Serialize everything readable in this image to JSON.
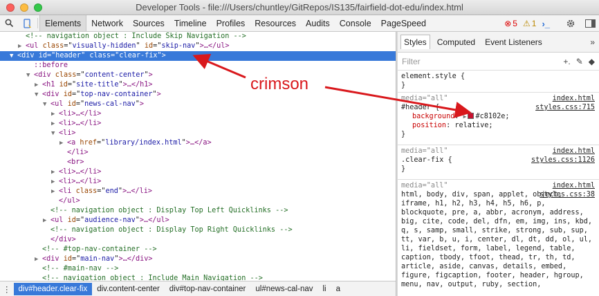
{
  "window": {
    "title": "Developer Tools - file:///Users/chuntley/GitRepos/IS135/fairfield-dot-edu/index.html",
    "light_colors": [
      "#fc605c",
      "#fdbc40",
      "#34c84a"
    ]
  },
  "toolbar": {
    "tabs": [
      "Elements",
      "Network",
      "Sources",
      "Timeline",
      "Profiles",
      "Resources",
      "Audits",
      "Console",
      "PageSpeed"
    ],
    "active_tab": "Elements",
    "error_count": "5",
    "warning_count": "1"
  },
  "dom_lines": [
    {
      "indent": 3,
      "tri": "",
      "kind": "comment",
      "text": "<!-- navigation object : Include Skip Navigation -->"
    },
    {
      "indent": 3,
      "tri": "▶",
      "kind": "tag",
      "tag": "ul",
      "attrs": [
        [
          "class",
          "visually-hidden"
        ],
        [
          "id",
          "skip-nav"
        ]
      ],
      "tail": "…</ul>"
    },
    {
      "indent": 2,
      "tri": "▼",
      "kind": "tag",
      "tag": "div",
      "attrs": [
        [
          "id",
          "header"
        ],
        [
          "class",
          "clear-fix"
        ]
      ],
      "tail": "",
      "selected": true
    },
    {
      "indent": 4,
      "tri": "",
      "kind": "pseudo",
      "text": "::before"
    },
    {
      "indent": 4,
      "tri": "▼",
      "kind": "tag",
      "tag": "div",
      "attrs": [
        [
          "class",
          "content-center"
        ]
      ],
      "tail": ""
    },
    {
      "indent": 5,
      "tri": "▶",
      "kind": "tag",
      "tag": "h1",
      "attrs": [
        [
          "id",
          "site-title"
        ]
      ],
      "tail": "…</h1>"
    },
    {
      "indent": 5,
      "tri": "▼",
      "kind": "tag",
      "tag": "div",
      "attrs": [
        [
          "id",
          "top-nav-container"
        ]
      ],
      "tail": ""
    },
    {
      "indent": 6,
      "tri": "▼",
      "kind": "tag",
      "tag": "ul",
      "attrs": [
        [
          "id",
          "news-cal-nav"
        ]
      ],
      "tail": ""
    },
    {
      "indent": 7,
      "tri": "▶",
      "kind": "tag",
      "tag": "li",
      "attrs": [],
      "tail": "…</li>"
    },
    {
      "indent": 7,
      "tri": "▶",
      "kind": "tag",
      "tag": "li",
      "attrs": [],
      "tail": "…</li>"
    },
    {
      "indent": 7,
      "tri": "▼",
      "kind": "tag",
      "tag": "li",
      "attrs": [],
      "tail": ""
    },
    {
      "indent": 8,
      "tri": "▶",
      "kind": "tag",
      "tag": "a",
      "attrs": [
        [
          "href",
          "library/index.html"
        ]
      ],
      "tail": "…</a>"
    },
    {
      "indent": 8,
      "tri": "",
      "kind": "close",
      "text": "</li>"
    },
    {
      "indent": 8,
      "tri": "",
      "kind": "close",
      "text": "<br>"
    },
    {
      "indent": 7,
      "tri": "▶",
      "kind": "tag",
      "tag": "li",
      "attrs": [],
      "tail": "…</li>"
    },
    {
      "indent": 7,
      "tri": "▶",
      "kind": "tag",
      "tag": "li",
      "attrs": [],
      "tail": "…</li>"
    },
    {
      "indent": 7,
      "tri": "▶",
      "kind": "tag",
      "tag": "li",
      "attrs": [
        [
          "class",
          "end"
        ]
      ],
      "tail": "…</li>"
    },
    {
      "indent": 7,
      "tri": "",
      "kind": "close",
      "text": "</ul>"
    },
    {
      "indent": 6,
      "tri": "",
      "kind": "comment",
      "text": "<!-- navigation object : Display Top Left Quicklinks -->"
    },
    {
      "indent": 6,
      "tri": "▶",
      "kind": "tag",
      "tag": "ul",
      "attrs": [
        [
          "id",
          "audience-nav"
        ]
      ],
      "tail": "…</ul>"
    },
    {
      "indent": 6,
      "tri": "",
      "kind": "comment",
      "text": "<!-- navigation object : Display Top Right Quicklinks -->"
    },
    {
      "indent": 6,
      "tri": "",
      "kind": "close",
      "text": "</div>"
    },
    {
      "indent": 5,
      "tri": "",
      "kind": "comment",
      "text": "<!-- #top-nav-container -->"
    },
    {
      "indent": 5,
      "tri": "▶",
      "kind": "tag",
      "tag": "div",
      "attrs": [
        [
          "id",
          "main-nav"
        ]
      ],
      "tail": "…</div>"
    },
    {
      "indent": 5,
      "tri": "",
      "kind": "comment",
      "text": "<!-- #main-nav -->"
    },
    {
      "indent": 5,
      "tri": "",
      "kind": "comment",
      "text": "<!-- navigation object : Include Main Navigation -->"
    }
  ],
  "sidebar": {
    "tabs": [
      "Styles",
      "Computed",
      "Event Listeners"
    ],
    "active_tab": "Styles",
    "filter_placeholder": "Filter",
    "element_style_selector": "element.style {",
    "close_brace": "}",
    "rule1": {
      "media": "media=\"all\"",
      "file": "index.html",
      "selector": "#header {",
      "source": "styles.css:715",
      "prop1_name": "background",
      "prop1_value": "#c8102e;",
      "prop2_name": "position",
      "prop2_value": "relative;",
      "swatch_color": "#c8102e"
    },
    "rule2": {
      "media": "media=\"all\"",
      "file": "index.html",
      "selector": ".clear-fix {",
      "source": "styles.css:1126"
    },
    "rule3": {
      "media": "media=\"all\"",
      "file": "index.html",
      "source": "styles.css:38",
      "selector": "html, body, div, span, applet, object, iframe, h1, h2, h3, h4, h5, h6, p, blockquote, pre, a, abbr, acronym, address, big, cite, code, del, dfn, em, img, ins, kbd, q, s, samp, small, strike, strong, sub, sup, tt, var, b, u, i, center, dl, dt, dd, ol, ul, li, fieldset, form, label, legend, table, caption, tbody, tfoot, thead, tr, th, td, article, aside, canvas, details, embed, figure, figcaption, footer, header, hgroup, menu, nav, output, ruby, section,"
    }
  },
  "breadcrumbs": [
    "div#header.clear-fix",
    "div.content-center",
    "div#top-nav-container",
    "ul#news-cal-nav",
    "li",
    "a"
  ],
  "annotation": {
    "label": "crimson",
    "color": "#d9181c"
  }
}
